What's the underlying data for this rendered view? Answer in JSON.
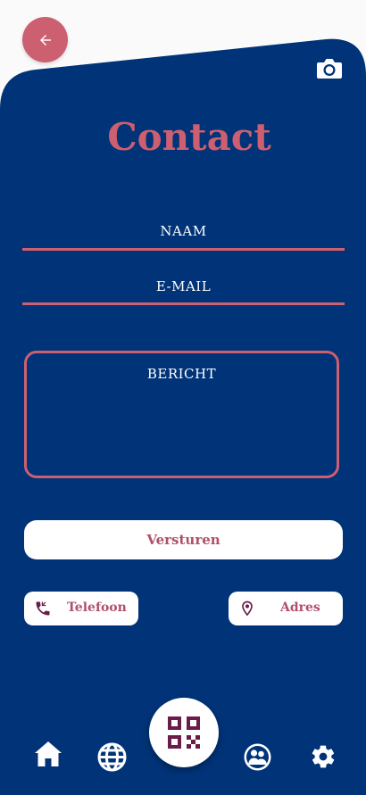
{
  "colors": {
    "primary_navy": "#003378",
    "accent_pink": "#cc5f70",
    "button_text": "#b0506a",
    "icon_purple": "#6b1d4a",
    "background": "#fafafa",
    "white": "#ffffff"
  },
  "header": {
    "back_icon": "arrow-left-icon",
    "camera_icon": "camera-icon"
  },
  "page": {
    "title": "Contact"
  },
  "form": {
    "name_label": "NAAM",
    "email_label": "E-MAIL",
    "message_label": "BERICHT",
    "submit_label": "Versturen"
  },
  "contact_options": [
    {
      "icon": "phone-icon",
      "label": "Telefoon"
    },
    {
      "icon": "location-pin-icon",
      "label": "Adres"
    }
  ],
  "bottom_nav": {
    "items": [
      {
        "icon": "home-icon"
      },
      {
        "icon": "globe-icon"
      },
      {
        "icon": "qr-code-icon"
      },
      {
        "icon": "users-icon"
      },
      {
        "icon": "gear-icon"
      }
    ]
  }
}
